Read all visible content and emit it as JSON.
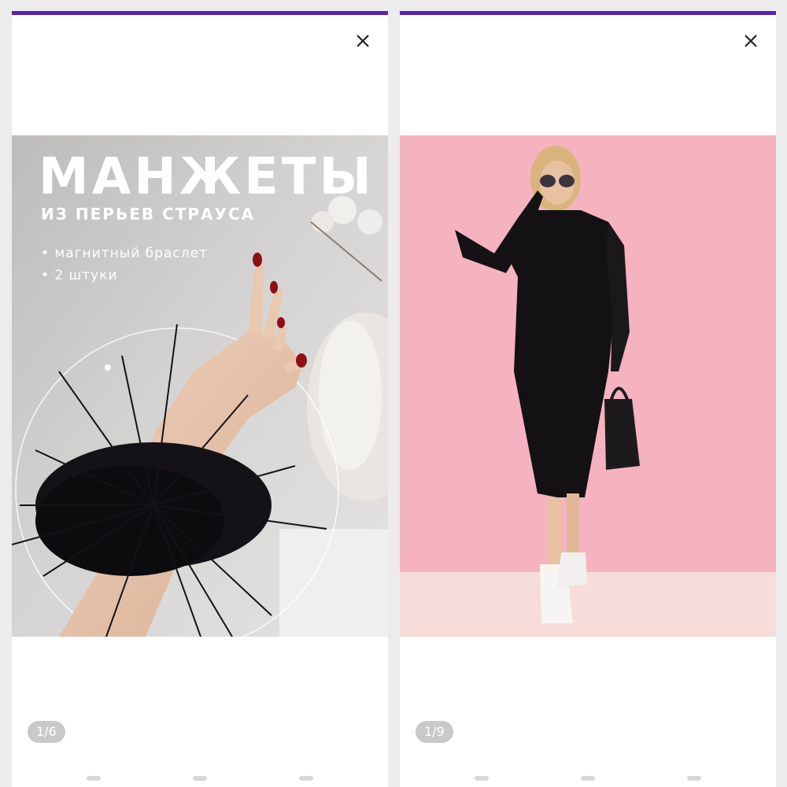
{
  "colors": {
    "progress": "#5b1fb5",
    "counter_bg": "#c9c9c9",
    "left_photo_bg": "#cdcccb",
    "right_photo_bg": "#f7b7c2"
  },
  "left_story": {
    "progress_fraction": 1.0,
    "close_icon": "close-icon",
    "counter": "1/6",
    "promo": {
      "title": "МАНЖЕТЫ",
      "subtitle": "ИЗ ПЕРЬЕВ СТРАУСА",
      "bullets": [
        "• магнитный браслет",
        "• 2 штуки"
      ]
    }
  },
  "right_story": {
    "progress_fraction": 1.0,
    "close_icon": "close-icon",
    "counter": "1/9"
  }
}
